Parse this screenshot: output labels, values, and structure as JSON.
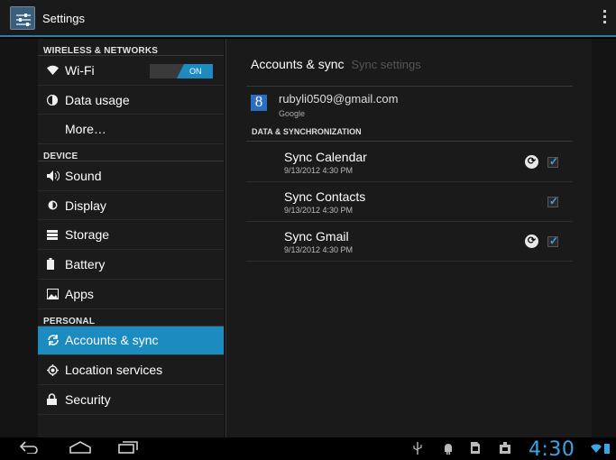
{
  "actionbar": {
    "title": "Settings"
  },
  "sidebar": {
    "sections": [
      {
        "header": "WIRELESS & NETWORKS"
      },
      {
        "header": "DEVICE"
      },
      {
        "header": "PERSONAL"
      }
    ],
    "items": [
      {
        "label": "Wi-Fi",
        "icon": "wifi-icon",
        "toggle": "ON"
      },
      {
        "label": "Data usage",
        "icon": "data-usage-icon"
      },
      {
        "label": "More…"
      },
      {
        "label": "Sound",
        "icon": "speaker-icon"
      },
      {
        "label": "Display",
        "icon": "brightness-icon"
      },
      {
        "label": "Storage",
        "icon": "storage-icon"
      },
      {
        "label": "Battery",
        "icon": "battery-icon"
      },
      {
        "label": "Apps",
        "icon": "apps-icon"
      },
      {
        "label": "Accounts & sync",
        "icon": "sync-icon",
        "selected": true
      },
      {
        "label": "Location services",
        "icon": "location-icon"
      },
      {
        "label": "Security",
        "icon": "lock-icon"
      }
    ]
  },
  "main": {
    "tabs": [
      {
        "label": "Accounts & sync",
        "active": true
      },
      {
        "label": "Sync settings",
        "active": false
      }
    ],
    "account": {
      "email": "rubyli0509@gmail.com",
      "type": "Google",
      "icon_letter": "8"
    },
    "section_header": "DATA & SYNCHRONIZATION",
    "sync_items": [
      {
        "title": "Sync Calendar",
        "date": "9/13/2012 4:30 PM",
        "syncing": true,
        "checked": true
      },
      {
        "title": "Sync Contacts",
        "date": "9/13/2012 4:30 PM",
        "syncing": false,
        "checked": true
      },
      {
        "title": "Sync Gmail",
        "date": "9/13/2012 4:30 PM",
        "syncing": true,
        "checked": true
      }
    ]
  },
  "statusbar": {
    "time": "4:30"
  },
  "colors": {
    "accent": "#1b8bc0",
    "clock": "#3aa6e6"
  }
}
